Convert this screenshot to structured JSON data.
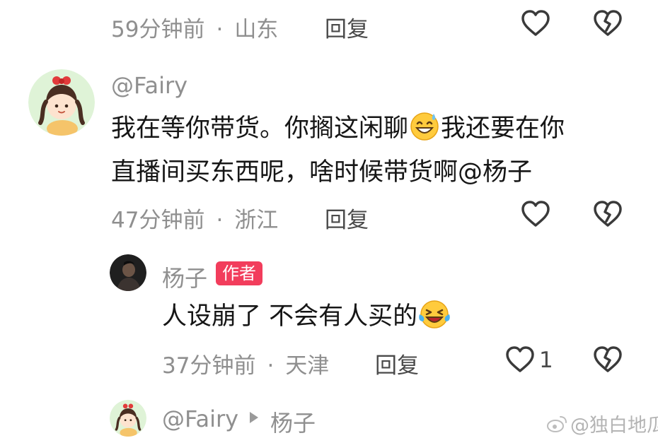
{
  "comment_top": {
    "time": "59分钟前",
    "location": "山东",
    "reply_label": "回复"
  },
  "comment_fairy": {
    "username": "@Fairy",
    "line1_a": "我在等你带货。你搁这闲聊",
    "line1_emoji": "sweat-smile-emoji",
    "line1_b": "我还要在你",
    "line2": "直播间买东西呢，啥时候带货啊@杨子",
    "time": "47分钟前",
    "location": "浙江",
    "reply_label": "回复"
  },
  "reply_yangzi": {
    "username": "杨子",
    "author_badge": "作者",
    "text": "人设崩了 不会有人买的",
    "text_emoji": "crying-laughing-emoji",
    "time": "37分钟前",
    "location": "天津",
    "reply_label": "回复",
    "like_count": "1"
  },
  "reply_next": {
    "from": "@Fairy",
    "to": "杨子"
  },
  "separator_dot": "·",
  "watermark": "@独白地瓜",
  "colors": {
    "text_primary": "#161616",
    "text_meta": "#8f8f8f",
    "author_badge": "#f23d5c",
    "icon_stroke": "#3a3a3a"
  },
  "icons": [
    "heart-outline-icon",
    "broken-heart-icon",
    "play-triangle-icon",
    "weibo-logo-icon"
  ]
}
